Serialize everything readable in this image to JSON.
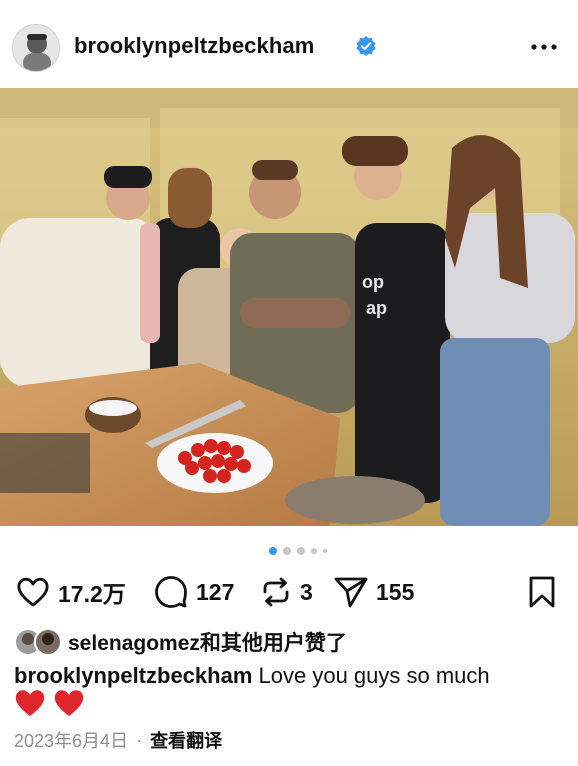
{
  "post": {
    "username": "brooklynpeltzbeckham",
    "caption_text": "Love you guys so much",
    "caption_emoji": "❤️❤️",
    "date": "2023年6月4日",
    "translate_label": "查看翻译"
  },
  "actions": {
    "likes_count": "17.2万",
    "comments_count": "127",
    "reposts_count": "3",
    "shares_count": "155"
  },
  "liked_by": {
    "user": "selenagomez",
    "rest": "和其他用户赞了"
  },
  "carousel": {
    "total": 5,
    "active": 1
  },
  "colors": {
    "verified": "#3897f0",
    "text": "#111111",
    "muted": "#8e8e8e",
    "dot_active": "#3897f0",
    "dot_inactive": "#c7c7c7"
  }
}
